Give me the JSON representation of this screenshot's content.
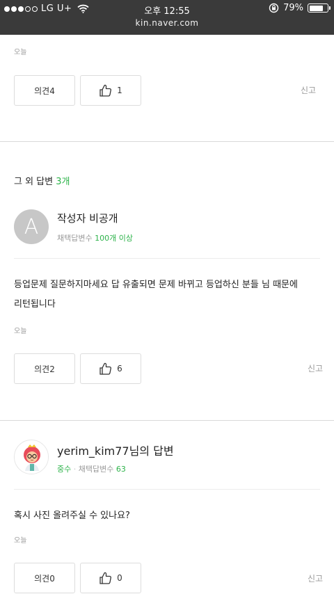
{
  "status_bar": {
    "carrier": "LG U+",
    "time": "오후 12:55",
    "battery": "79%",
    "battery_level": 0.79
  },
  "browser": {
    "url": "kin.naver.com"
  },
  "prev_answer": {
    "date": "오늘",
    "comment_label": "의견4",
    "like_count": "1",
    "report_label": "신고"
  },
  "other_answers": {
    "title_prefix": "그 외 답변",
    "count": "3개"
  },
  "answer1": {
    "avatar_letter": "A",
    "name": "작성자 비공개",
    "meta_label": "채택답변수",
    "meta_value": "100개 이상",
    "body_line1": "등업문제 질문하지마세요 답 유출되면 문제 바뀌고 등업하신 분들 님 때문에",
    "body_line2": "리턴됩니다",
    "date": "오늘",
    "comment_label": "의견2",
    "like_count": "6",
    "report_label": "신고"
  },
  "answer2": {
    "name": "yerim_kim77님의 답변",
    "level": "중수",
    "meta_label": "채택답변수",
    "meta_value": "63",
    "body": "혹시 사진 올려주실 수 있나요?",
    "date": "오늘",
    "comment_label": "의견0",
    "like_count": "0",
    "report_label": "신고"
  },
  "colors": {
    "accent": "#2db34a",
    "topbar": "#3a3a3a",
    "divider": "#d9d9d9"
  }
}
